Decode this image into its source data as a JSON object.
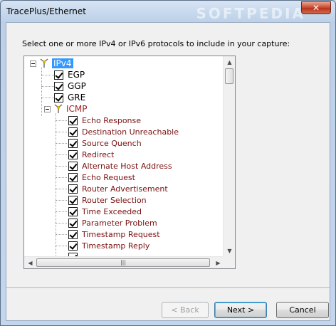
{
  "window": {
    "title": "TracePlus/Ethernet",
    "close_glyph": "✕"
  },
  "dialog": {
    "prompt": "Select one or more IPv4 or IPv6 protocols to include in your capture:"
  },
  "tree": {
    "root": {
      "label": "IPv4",
      "selected": true,
      "icon": "protocol-node-icon"
    },
    "top_items": [
      {
        "label": "EGP",
        "checked": true
      },
      {
        "label": "GGP",
        "checked": true
      },
      {
        "label": "GRE",
        "checked": true
      }
    ],
    "icmp": {
      "label": "ICMP",
      "icon": "protocol-node-icon"
    },
    "icmp_items": [
      {
        "label": "Echo Response",
        "checked": true
      },
      {
        "label": "Destination Unreachable",
        "checked": true
      },
      {
        "label": "Source Quench",
        "checked": true
      },
      {
        "label": "Redirect",
        "checked": true
      },
      {
        "label": "Alternate Host Address",
        "checked": true
      },
      {
        "label": "Echo Request",
        "checked": true
      },
      {
        "label": "Router Advertisement",
        "checked": true
      },
      {
        "label": "Router Selection",
        "checked": true
      },
      {
        "label": "Time Exceeded",
        "checked": true
      },
      {
        "label": "Parameter Problem",
        "checked": true
      },
      {
        "label": "Timestamp Request",
        "checked": true
      },
      {
        "label": "Timestamp Reply",
        "checked": true
      }
    ]
  },
  "scrollbars": {
    "up": "▲",
    "down": "▼",
    "left": "◀",
    "right": "▶",
    "grip": "|||"
  },
  "buttons": {
    "back": "< Back",
    "next": "Next >",
    "cancel": "Cancel"
  },
  "watermark": "SOFTPEDIA"
}
